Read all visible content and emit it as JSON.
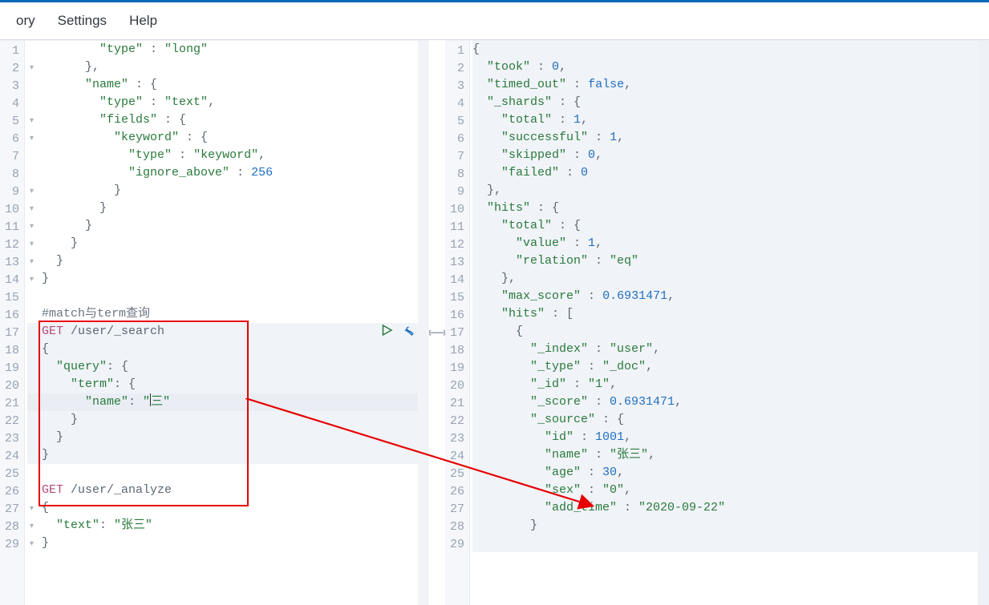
{
  "menus": {
    "history": "ory",
    "settings": "Settings",
    "help": "Help"
  },
  "divider_glyph": "⟷",
  "left": {
    "gutter_start": 1,
    "lines": [
      {
        "indent": 10,
        "tokens": [
          {
            "t": "key",
            "v": "\"type\""
          },
          {
            "t": "punc",
            "v": " : "
          },
          {
            "t": "str",
            "v": "\"long\""
          }
        ]
      },
      {
        "indent": 8,
        "tokens": [
          {
            "t": "punc",
            "v": "},"
          }
        ],
        "fold": true
      },
      {
        "indent": 8,
        "tokens": [
          {
            "t": "key",
            "v": "\"name\""
          },
          {
            "t": "punc",
            "v": " : {"
          }
        ]
      },
      {
        "indent": 10,
        "tokens": [
          {
            "t": "key",
            "v": "\"type\""
          },
          {
            "t": "punc",
            "v": " : "
          },
          {
            "t": "str",
            "v": "\"text\""
          },
          {
            "t": "punc",
            "v": ","
          }
        ]
      },
      {
        "indent": 10,
        "tokens": [
          {
            "t": "key",
            "v": "\"fields\""
          },
          {
            "t": "punc",
            "v": " : {"
          }
        ],
        "fold": true
      },
      {
        "indent": 12,
        "tokens": [
          {
            "t": "key",
            "v": "\"keyword\""
          },
          {
            "t": "punc",
            "v": " : {"
          }
        ],
        "fold": true
      },
      {
        "indent": 14,
        "tokens": [
          {
            "t": "key",
            "v": "\"type\""
          },
          {
            "t": "punc",
            "v": " : "
          },
          {
            "t": "str",
            "v": "\"keyword\""
          },
          {
            "t": "punc",
            "v": ","
          }
        ]
      },
      {
        "indent": 14,
        "tokens": [
          {
            "t": "key",
            "v": "\"ignore_above\""
          },
          {
            "t": "punc",
            "v": " : "
          },
          {
            "t": "num",
            "v": "256"
          }
        ]
      },
      {
        "indent": 12,
        "tokens": [
          {
            "t": "punc",
            "v": "}"
          }
        ],
        "fold": true
      },
      {
        "indent": 10,
        "tokens": [
          {
            "t": "punc",
            "v": "}"
          }
        ],
        "fold": true
      },
      {
        "indent": 8,
        "tokens": [
          {
            "t": "punc",
            "v": "}"
          }
        ],
        "fold": true
      },
      {
        "indent": 6,
        "tokens": [
          {
            "t": "punc",
            "v": "}"
          }
        ],
        "fold": true
      },
      {
        "indent": 4,
        "tokens": [
          {
            "t": "punc",
            "v": "}"
          }
        ],
        "fold": true
      },
      {
        "indent": 2,
        "tokens": [
          {
            "t": "punc",
            "v": "}"
          }
        ],
        "fold": true
      },
      {
        "indent": 0,
        "tokens": []
      },
      {
        "indent": 2,
        "tokens": [
          {
            "t": "comment",
            "v": "#match与term查询"
          }
        ]
      },
      {
        "indent": 2,
        "tokens": [
          {
            "t": "method",
            "v": "GET"
          },
          {
            "t": "path",
            "v": " /user/_search"
          }
        ],
        "hl": true,
        "actions": true
      },
      {
        "indent": 2,
        "tokens": [
          {
            "t": "punc",
            "v": "{"
          }
        ],
        "hl": true,
        "fold": true
      },
      {
        "indent": 4,
        "tokens": [
          {
            "t": "key",
            "v": "\"query\""
          },
          {
            "t": "punc",
            "v": ": {"
          }
        ],
        "hl": true,
        "fold": true
      },
      {
        "indent": 6,
        "tokens": [
          {
            "t": "key",
            "v": "\"term\""
          },
          {
            "t": "punc",
            "v": ": {"
          }
        ],
        "hl": true,
        "fold": true
      },
      {
        "indent": 8,
        "tokens": [
          {
            "t": "key",
            "v": "\"name\""
          },
          {
            "t": "punc",
            "v": ": "
          },
          {
            "t": "str",
            "v": "\"三\""
          }
        ],
        "hl": true,
        "cursor": true
      },
      {
        "indent": 6,
        "tokens": [
          {
            "t": "punc",
            "v": "}"
          }
        ],
        "hl": true
      },
      {
        "indent": 4,
        "tokens": [
          {
            "t": "punc",
            "v": "}"
          }
        ],
        "hl": true
      },
      {
        "indent": 2,
        "tokens": [
          {
            "t": "punc",
            "v": "}"
          }
        ],
        "hl": true
      },
      {
        "indent": 0,
        "tokens": []
      },
      {
        "indent": 2,
        "tokens": [
          {
            "t": "method",
            "v": "GET"
          },
          {
            "t": "path",
            "v": " /user/_analyze"
          }
        ]
      },
      {
        "indent": 2,
        "tokens": [
          {
            "t": "punc",
            "v": "{"
          }
        ],
        "fold": true
      },
      {
        "indent": 4,
        "tokens": [
          {
            "t": "key",
            "v": "\"text\""
          },
          {
            "t": "punc",
            "v": ": "
          },
          {
            "t": "str",
            "v": "\"张三\""
          }
        ],
        "fold": true
      },
      {
        "indent": 2,
        "tokens": [
          {
            "t": "punc",
            "v": "}"
          }
        ],
        "fold": true
      }
    ]
  },
  "right": {
    "gutter_start": 1,
    "lines": [
      {
        "indent": 0,
        "tokens": [
          {
            "t": "punc",
            "v": "{"
          }
        ],
        "hl": true,
        "fold": true
      },
      {
        "indent": 2,
        "tokens": [
          {
            "t": "key",
            "v": "\"took\""
          },
          {
            "t": "punc",
            "v": " : "
          },
          {
            "t": "num",
            "v": "0"
          },
          {
            "t": "punc",
            "v": ","
          }
        ],
        "hl": true
      },
      {
        "indent": 2,
        "tokens": [
          {
            "t": "key",
            "v": "\"timed_out\""
          },
          {
            "t": "punc",
            "v": " : "
          },
          {
            "t": "kw",
            "v": "false"
          },
          {
            "t": "punc",
            "v": ","
          }
        ],
        "hl": true
      },
      {
        "indent": 2,
        "tokens": [
          {
            "t": "key",
            "v": "\"_shards\""
          },
          {
            "t": "punc",
            "v": " : {"
          }
        ],
        "hl": true,
        "fold": true
      },
      {
        "indent": 4,
        "tokens": [
          {
            "t": "key",
            "v": "\"total\""
          },
          {
            "t": "punc",
            "v": " : "
          },
          {
            "t": "num",
            "v": "1"
          },
          {
            "t": "punc",
            "v": ","
          }
        ],
        "hl": true
      },
      {
        "indent": 4,
        "tokens": [
          {
            "t": "key",
            "v": "\"successful\""
          },
          {
            "t": "punc",
            "v": " : "
          },
          {
            "t": "num",
            "v": "1"
          },
          {
            "t": "punc",
            "v": ","
          }
        ],
        "hl": true
      },
      {
        "indent": 4,
        "tokens": [
          {
            "t": "key",
            "v": "\"skipped\""
          },
          {
            "t": "punc",
            "v": " : "
          },
          {
            "t": "num",
            "v": "0"
          },
          {
            "t": "punc",
            "v": ","
          }
        ],
        "hl": true
      },
      {
        "indent": 4,
        "tokens": [
          {
            "t": "key",
            "v": "\"failed\""
          },
          {
            "t": "punc",
            "v": " : "
          },
          {
            "t": "num",
            "v": "0"
          }
        ],
        "hl": true
      },
      {
        "indent": 2,
        "tokens": [
          {
            "t": "punc",
            "v": "},"
          }
        ],
        "hl": true,
        "fold": true
      },
      {
        "indent": 2,
        "tokens": [
          {
            "t": "key",
            "v": "\"hits\""
          },
          {
            "t": "punc",
            "v": " : {"
          }
        ],
        "hl": true,
        "fold": true
      },
      {
        "indent": 4,
        "tokens": [
          {
            "t": "key",
            "v": "\"total\""
          },
          {
            "t": "punc",
            "v": " : {"
          }
        ],
        "hl": true,
        "fold": true
      },
      {
        "indent": 6,
        "tokens": [
          {
            "t": "key",
            "v": "\"value\""
          },
          {
            "t": "punc",
            "v": " : "
          },
          {
            "t": "num",
            "v": "1"
          },
          {
            "t": "punc",
            "v": ","
          }
        ],
        "hl": true
      },
      {
        "indent": 6,
        "tokens": [
          {
            "t": "key",
            "v": "\"relation\""
          },
          {
            "t": "punc",
            "v": " : "
          },
          {
            "t": "str",
            "v": "\"eq\""
          }
        ],
        "hl": true
      },
      {
        "indent": 4,
        "tokens": [
          {
            "t": "punc",
            "v": "},"
          }
        ],
        "hl": true,
        "fold": true
      },
      {
        "indent": 4,
        "tokens": [
          {
            "t": "key",
            "v": "\"max_score\""
          },
          {
            "t": "punc",
            "v": " : "
          },
          {
            "t": "num",
            "v": "0.6931471"
          },
          {
            "t": "punc",
            "v": ","
          }
        ],
        "hl": true
      },
      {
        "indent": 4,
        "tokens": [
          {
            "t": "key",
            "v": "\"hits\""
          },
          {
            "t": "punc",
            "v": " : ["
          }
        ],
        "hl": true,
        "fold": true
      },
      {
        "indent": 6,
        "tokens": [
          {
            "t": "punc",
            "v": "{"
          }
        ],
        "hl": true,
        "fold": true
      },
      {
        "indent": 8,
        "tokens": [
          {
            "t": "key",
            "v": "\"_index\""
          },
          {
            "t": "punc",
            "v": " : "
          },
          {
            "t": "str",
            "v": "\"user\""
          },
          {
            "t": "punc",
            "v": ","
          }
        ],
        "hl": true
      },
      {
        "indent": 8,
        "tokens": [
          {
            "t": "key",
            "v": "\"_type\""
          },
          {
            "t": "punc",
            "v": " : "
          },
          {
            "t": "str",
            "v": "\"_doc\""
          },
          {
            "t": "punc",
            "v": ","
          }
        ],
        "hl": true
      },
      {
        "indent": 8,
        "tokens": [
          {
            "t": "key",
            "v": "\"_id\""
          },
          {
            "t": "punc",
            "v": " : "
          },
          {
            "t": "str",
            "v": "\"1\""
          },
          {
            "t": "punc",
            "v": ","
          }
        ],
        "hl": true
      },
      {
        "indent": 8,
        "tokens": [
          {
            "t": "key",
            "v": "\"_score\""
          },
          {
            "t": "punc",
            "v": " : "
          },
          {
            "t": "num",
            "v": "0.6931471"
          },
          {
            "t": "punc",
            "v": ","
          }
        ],
        "hl": true
      },
      {
        "indent": 8,
        "tokens": [
          {
            "t": "key",
            "v": "\"_source\""
          },
          {
            "t": "punc",
            "v": " : {"
          }
        ],
        "hl": true,
        "fold": true
      },
      {
        "indent": 10,
        "tokens": [
          {
            "t": "key",
            "v": "\"id\""
          },
          {
            "t": "punc",
            "v": " : "
          },
          {
            "t": "num",
            "v": "1001"
          },
          {
            "t": "punc",
            "v": ","
          }
        ],
        "hl": true
      },
      {
        "indent": 10,
        "tokens": [
          {
            "t": "key",
            "v": "\"name\""
          },
          {
            "t": "punc",
            "v": " : "
          },
          {
            "t": "str",
            "v": "\"张三\""
          },
          {
            "t": "punc",
            "v": ","
          }
        ],
        "hl": true
      },
      {
        "indent": 10,
        "tokens": [
          {
            "t": "key",
            "v": "\"age\""
          },
          {
            "t": "punc",
            "v": " : "
          },
          {
            "t": "num",
            "v": "30"
          },
          {
            "t": "punc",
            "v": ","
          }
        ],
        "hl": true
      },
      {
        "indent": 10,
        "tokens": [
          {
            "t": "key",
            "v": "\"sex\""
          },
          {
            "t": "punc",
            "v": " : "
          },
          {
            "t": "str",
            "v": "\"0\""
          },
          {
            "t": "punc",
            "v": ","
          }
        ],
        "hl": true
      },
      {
        "indent": 10,
        "tokens": [
          {
            "t": "key",
            "v": "\"add_time\""
          },
          {
            "t": "punc",
            "v": " : "
          },
          {
            "t": "str",
            "v": "\"2020-09-22\""
          }
        ],
        "hl": true
      },
      {
        "indent": 8,
        "tokens": [
          {
            "t": "punc",
            "v": "}"
          }
        ],
        "hl": true,
        "fold": true
      },
      {
        "indent": 6,
        "tokens": [
          {
            "t": "punc",
            "v": ""
          }
        ],
        "hl": true
      }
    ]
  }
}
